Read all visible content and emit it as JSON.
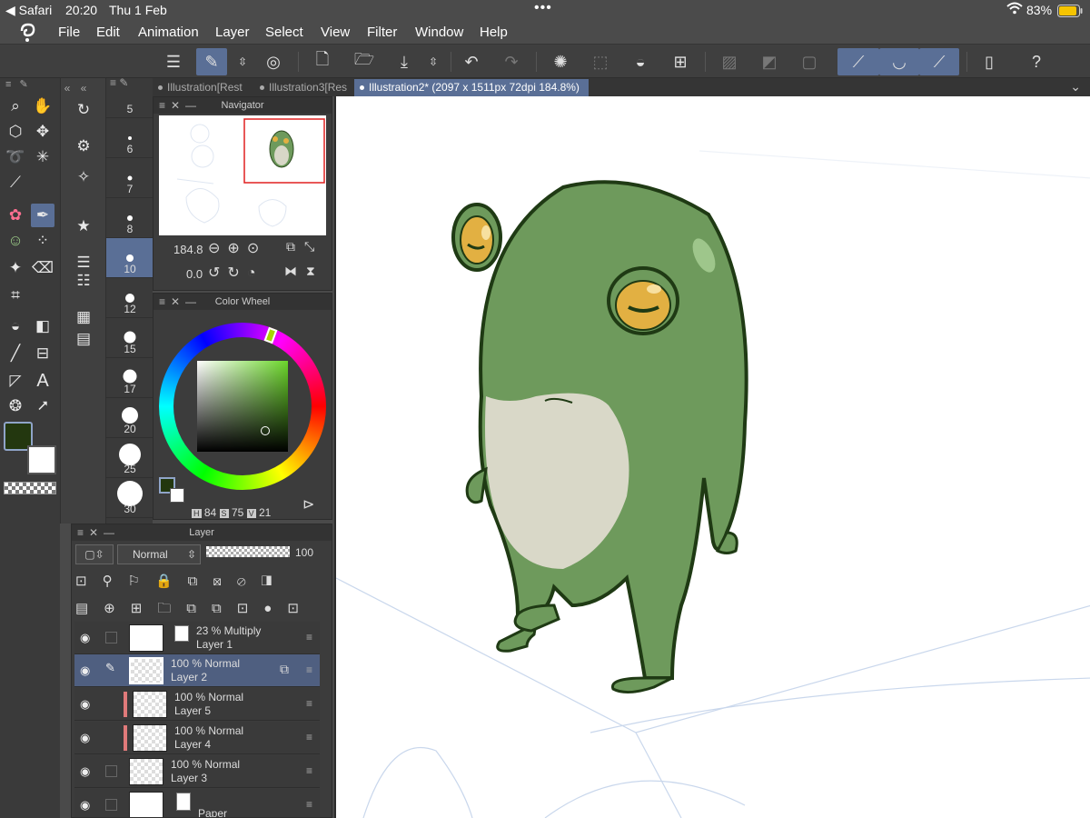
{
  "status": {
    "left": "◀ Safari",
    "time": "20:20",
    "date": "Thu 1 Feb",
    "battery": "83%"
  },
  "menu": [
    "File",
    "Edit",
    "Animation",
    "Layer",
    "Select",
    "View",
    "Filter",
    "Window",
    "Help"
  ],
  "brush_sizes": [
    "5",
    "6",
    "7",
    "8",
    "10",
    "12",
    "15",
    "17",
    "20",
    "25",
    "30"
  ],
  "tabs": [
    "Illustration[Rest",
    "Illustration3[Res",
    "Illustration2* (2097 x 1511px 72dpi 184.8%)"
  ],
  "navigator": {
    "title": "Navigator",
    "zoom": "184.8",
    "angle": "0.0"
  },
  "color_wheel": {
    "title": "Color Wheel",
    "h_label": "H",
    "h": "84",
    "s_label": "S",
    "s": "75",
    "v_label": "V",
    "v": "21",
    "main_color": "#23370f"
  },
  "layer_panel": {
    "title": "Layer",
    "blend": "Normal",
    "opacity": "100",
    "layers": [
      {
        "mode": "23 %  Multiply",
        "name": "Layer 1"
      },
      {
        "mode": "100 %  Normal",
        "name": "Layer 2"
      },
      {
        "mode": "100 %  Normal",
        "name": "Layer 5"
      },
      {
        "mode": "100 %  Normal",
        "name": "Layer 4"
      },
      {
        "mode": "100 %  Normal",
        "name": "Layer 3"
      },
      {
        "mode": "",
        "name": "Paper"
      }
    ]
  }
}
